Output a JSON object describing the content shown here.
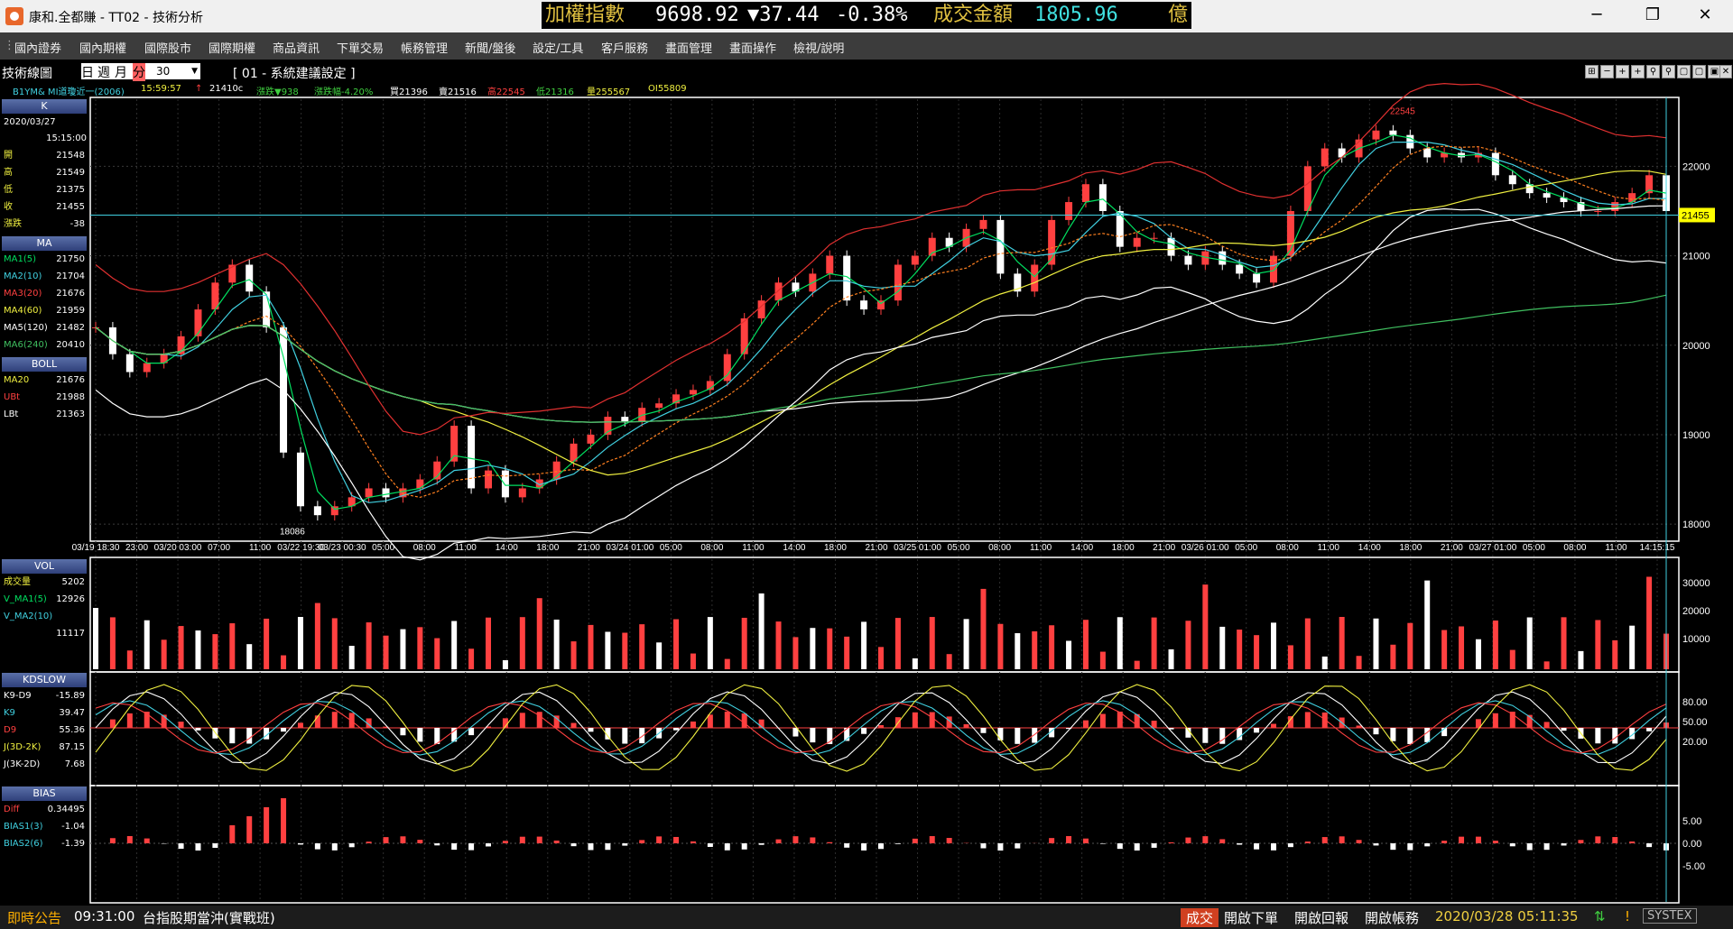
{
  "window": {
    "title": "康和.全都賺 - TT02 - 技術分析",
    "min_label": "─",
    "max_label": "❐",
    "close_label": "✕"
  },
  "ticker": {
    "index_label": "加權指數",
    "index_value": "9698.92",
    "index_change": "▼37.44",
    "index_pct": "-0.38%",
    "turnover_label": "成交金額",
    "turnover_value": "1805.96",
    "turnover_unit": "億",
    "colors": {
      "label": "#e0c040",
      "value": "#ffffff",
      "down": "#ffffff",
      "turnover": "#40e0e0"
    }
  },
  "menu": [
    "國內證券",
    "國內期權",
    "國際股市",
    "國際期權",
    "商品資訊",
    "下單交易",
    "帳務管理",
    "新聞/盤後",
    "設定/工具",
    "客戶服務",
    "畫面管理",
    "畫面操作",
    "檢視/說明"
  ],
  "toolbar": {
    "panel_label": "技術線圖",
    "periods": [
      "日",
      "週",
      "月",
      "分"
    ],
    "active_period": "分",
    "interval_value": "30",
    "setting_label": "[ 01 - 系統建議設定 ]",
    "buttons": [
      "⊞",
      "─",
      "+",
      "+",
      "⚲",
      "⚲",
      "▢",
      "▢",
      "▣",
      "✕"
    ]
  },
  "info": {
    "symbol": "B1YM&  MI道瓊近一(2006)",
    "time": "15:59:57",
    "arrow": "↑",
    "close": "21410c",
    "change": "漲跌▼938",
    "change_pct": "漲跌幅-4.20%",
    "bid": "買21396",
    "ask": "賣21516",
    "high": "高22545",
    "low": "低21316",
    "volume": "量255567",
    "oi": "OI55809"
  },
  "left_panel": {
    "k_header": "K",
    "date": "2020/03/27",
    "time": "15:15:00",
    "ohlc": [
      {
        "label": "開",
        "value": "21548"
      },
      {
        "label": "高",
        "value": "21549"
      },
      {
        "label": "低",
        "value": "21375"
      },
      {
        "label": "收",
        "value": "21455"
      },
      {
        "label": "漲跌",
        "value": "-38"
      }
    ],
    "ma_header": "MA",
    "ma": [
      {
        "label": "MA1(5)",
        "value": "21750",
        "color": "#00e060"
      },
      {
        "label": "MA2(10)",
        "value": "21704",
        "color": "#40d0e0"
      },
      {
        "label": "MA3(20)",
        "value": "21676",
        "color": "#ff4040"
      },
      {
        "label": "MA4(60)",
        "value": "21959",
        "color": "#f0f040"
      },
      {
        "label": "MA5(120)",
        "value": "21482",
        "color": "#ffffff"
      },
      {
        "label": "MA6(240)",
        "value": "20410",
        "color": "#40c060"
      }
    ],
    "boll_header": "BOLL",
    "boll": [
      {
        "label": "MA20",
        "value": "21676",
        "color": "#f0f040"
      },
      {
        "label": "UBt",
        "value": "21988",
        "color": "#ff4040"
      },
      {
        "label": "LBt",
        "value": "21363",
        "color": "#ffffff"
      }
    ],
    "vol_header": "VOL",
    "vol": [
      {
        "label": "成交量",
        "value": "5202",
        "color": "#f0f040"
      },
      {
        "label": "V_MA1(5)",
        "value": "12926",
        "color": "#00e060"
      },
      {
        "label": "V_MA2(10)",
        "value": "",
        "color": "#40d0e0"
      },
      {
        "label": "",
        "value": "11117",
        "color": "#40d0e0"
      }
    ],
    "kd_header": "KDSLOW",
    "kd": [
      {
        "label": "K9-D9",
        "value": "-15.89",
        "color": "#ffffff"
      },
      {
        "label": "K9",
        "value": "39.47",
        "color": "#40d0e0"
      },
      {
        "label": "D9",
        "value": "55.36",
        "color": "#ff4040"
      },
      {
        "label": "J(3D-2K)",
        "value": "87.15",
        "color": "#f0f040"
      },
      {
        "label": "J(3K-2D)",
        "value": "7.68",
        "color": "#ffffff"
      }
    ],
    "bias_header": "BIAS",
    "bias": [
      {
        "label": "Diff",
        "value": "0.34495",
        "color": "#ff4040"
      },
      {
        "label": "BIAS1(3)",
        "value": "-1.04",
        "color": "#40d0e0"
      },
      {
        "label": "BIAS2(6)",
        "value": "-1.39",
        "color": "#40d0e0"
      }
    ]
  },
  "chart_data": {
    "type": "candlestick",
    "price_ticks": [
      "22000",
      "21000",
      "20000",
      "19000",
      "18000"
    ],
    "price_range": [
      17850,
      22750
    ],
    "last_price_tag": "21455",
    "high_label": "22545",
    "low_label": "18086",
    "time_labels": [
      "03/19 18:30",
      "23:00",
      "03/20 03:00",
      "07:00",
      "11:00",
      "03/22 19:30",
      "03/23 00:30",
      "05:00",
      "08:00",
      "11:00",
      "14:00",
      "18:00",
      "21:00",
      "03/24 01:00",
      "05:00",
      "08:00",
      "11:00",
      "14:00",
      "18:00",
      "21:00",
      "03/25 01:00",
      "05:00",
      "08:00",
      "11:00",
      "14:00",
      "18:00",
      "21:00",
      "03/26 01:00",
      "05:00",
      "08:00",
      "11:00",
      "14:00",
      "18:00",
      "21:00",
      "03/27 01:00",
      "05:00",
      "08:00",
      "11:00",
      "14:15:15"
    ],
    "price_path": [
      20200,
      19900,
      19700,
      19800,
      19900,
      20100,
      20400,
      20700,
      20900,
      20600,
      20200,
      18800,
      18200,
      18100,
      18200,
      18300,
      18400,
      18300,
      18400,
      18500,
      18700,
      19100,
      18400,
      18600,
      18300,
      18400,
      18500,
      18700,
      18900,
      19000,
      19200,
      19150,
      19300,
      19350,
      19450,
      19500,
      19600,
      19900,
      20300,
      20500,
      20700,
      20600,
      20800,
      21000,
      20500,
      20400,
      20500,
      20900,
      21000,
      21200,
      21100,
      21300,
      21400,
      20800,
      20600,
      20900,
      21400,
      21600,
      21800,
      21500,
      21100,
      21200,
      21200,
      21000,
      20900,
      21050,
      20900,
      20800,
      20700,
      21000,
      21500,
      22000,
      22200,
      22100,
      22300,
      22400,
      22350,
      22200,
      22100,
      22150,
      22100,
      22150,
      21900,
      21800,
      21700,
      21650,
      21600,
      21500,
      21500,
      21600,
      21700,
      21900,
      21500
    ],
    "vol_ticks": [
      "30000",
      "20000",
      "10000"
    ],
    "kd_ticks": [
      "80.00",
      "50.00",
      "20.00"
    ],
    "bias_ticks": [
      "5.00",
      "0.00",
      "-5.00"
    ]
  },
  "status": {
    "notice_label": "即時公告",
    "notice_time": "09:31:00",
    "notice_text": "台指股期當沖(實戰班)",
    "trade_label": "成交",
    "btn_order": "開啟下單",
    "btn_report": "開啟回報",
    "btn_account": "開啟帳務",
    "datetime": "2020/03/28 05:11:35",
    "brand": "SYSTEX"
  }
}
